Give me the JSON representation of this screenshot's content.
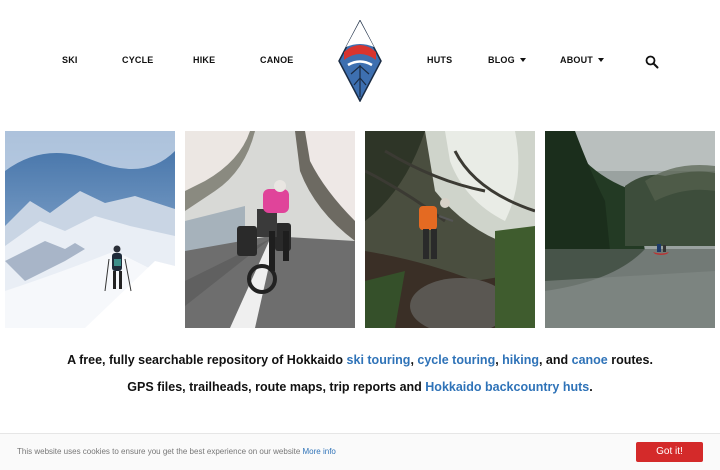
{
  "nav": {
    "left_items": [
      "SKI",
      "CYCLE",
      "HIKE",
      "CANOE"
    ],
    "right_items": [
      {
        "label": "HUTS",
        "dropdown": false
      },
      {
        "label": "BLOG",
        "dropdown": true
      },
      {
        "label": "ABOUT",
        "dropdown": true
      }
    ],
    "logo_icon": "mountain-diamond-logo",
    "search_icon": "search-icon"
  },
  "photos": [
    {
      "name": "ski-photo"
    },
    {
      "name": "cycle-photo"
    },
    {
      "name": "hike-photo"
    },
    {
      "name": "canoe-photo"
    }
  ],
  "tagline": {
    "line1_prefix": "A free, fully searchable repository of Hokkaido ",
    "ski_link": "ski touring",
    "sep1": ", ",
    "cycle_link": "cycle touring",
    "sep2": ", ",
    "hike_link": "hiking",
    "sep3": ", and ",
    "canoe_link": "canoe",
    "line1_suffix": " routes.",
    "line2_prefix": "GPS files, trailheads, route maps, trip reports and ",
    "huts_link": "Hokkaido backcountry huts",
    "line2_suffix": "."
  },
  "cookie": {
    "text": "This website uses cookies to ensure you get the best experience on our website",
    "more_info": "More info",
    "button": "Got it!"
  },
  "colors": {
    "link": "#2f73b8",
    "logo_blue": "#3d6fb0",
    "logo_red": "#d8342f",
    "button_red": "#d42a2a"
  }
}
